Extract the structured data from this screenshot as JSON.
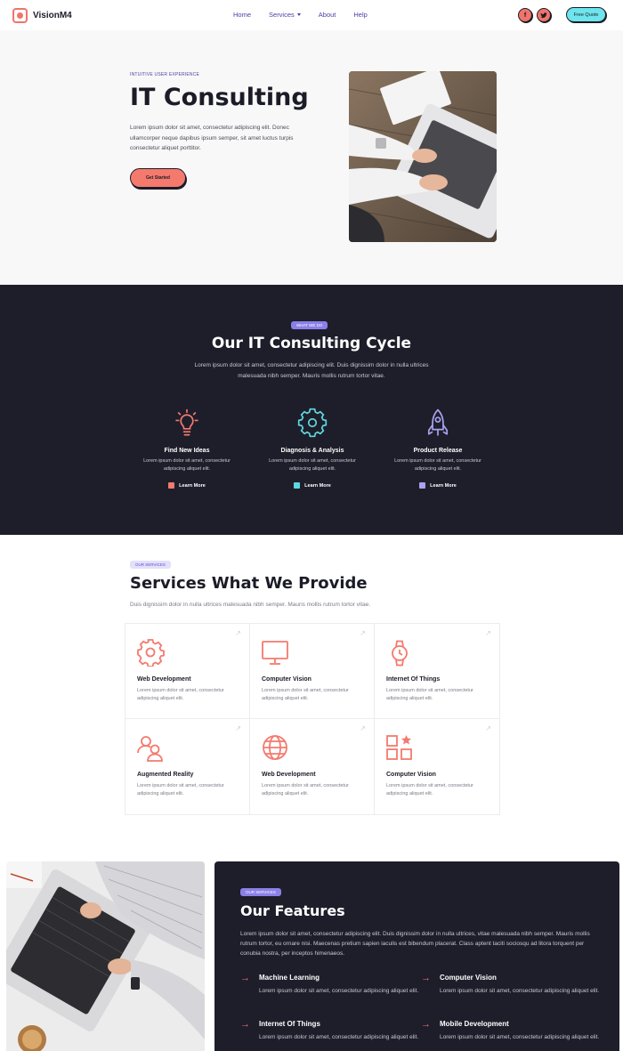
{
  "nav": {
    "logo": "VisionM4",
    "menu": [
      "Home",
      "Services",
      "About",
      "Help"
    ],
    "social": [
      "f",
      "t"
    ],
    "cta": "Free Quote"
  },
  "hero": {
    "eyebrow": "INTUITIVE USER EXPERIENCE",
    "title": "IT Consulting",
    "text": "Lorem ipsum dolor sit amet, consectetur adipiscing elit. Donec ullamcorper neque dapibus ipsum semper, sit amet luctus turpis consectetur aliquet porttitor.",
    "button": "Get Started"
  },
  "cycle": {
    "pill": "WHAT WE DO",
    "title": "Our IT Consulting Cycle",
    "text": "Lorem ipsum dolor sit amet, consectetur adipiscing elit. Duis dignissim dolor in nulla ultrices malesuada nibh semper. Mauris mollis rutrum tortor vitae.",
    "steps": [
      {
        "title": "Find New Ideas",
        "text": "Lorem ipsum dolor sit amet, consectetur adipiscing aliquet elit.",
        "link": "Learn More",
        "icon": "lightbulb-icon",
        "color": "#f47a6e"
      },
      {
        "title": "Diagnosis & Analysis",
        "text": "Lorem ipsum dolor sit amet, consectetur adipiscing aliquet elit.",
        "link": "Learn More",
        "icon": "gear-icon",
        "color": "#5fd8df"
      },
      {
        "title": "Product Release",
        "text": "Lorem ipsum dolor sit amet, consectetur adipiscing aliquet elit.",
        "link": "Learn More",
        "icon": "rocket-icon",
        "color": "#a9a2f0"
      }
    ]
  },
  "services": {
    "pill": "OUR SERVICES",
    "title": "Services What We Provide",
    "text": "Duis dignissim dolor in nulla ultrices malesuada nibh semper. Mauris mollis rutrum tortor vitae.",
    "items": [
      {
        "title": "Web Development",
        "text": "Lorem ipsum dolor sit amet, consectetur adipiscing aliquet elit.",
        "icon": "gear-icon"
      },
      {
        "title": "Computer Vision",
        "text": "Lorem ipsum dolor sit amet, consectetur adipiscing aliquet elit.",
        "icon": "monitor-icon"
      },
      {
        "title": "Internet Of Things",
        "text": "Lorem ipsum dolor sit amet, consectetur adipiscing aliquet elit.",
        "icon": "watch-icon"
      },
      {
        "title": "Augmented Reality",
        "text": "Lorem ipsum dolor sit amet, consectetur adipiscing aliquet elit.",
        "icon": "users-icon"
      },
      {
        "title": "Web Development",
        "text": "Lorem ipsum dolor sit amet, consectetur adipiscing aliquet elit.",
        "icon": "globe-icon"
      },
      {
        "title": "Computer Vision",
        "text": "Lorem ipsum dolor sit amet, consectetur adipiscing aliquet elit.",
        "icon": "grid-star-icon"
      }
    ]
  },
  "features": {
    "pill": "OUR SERVICES",
    "title": "Our Features",
    "text": "Lorem ipsum dolor sit amet, consectetur adipiscing elit. Duis dignissim dolor in nulla ultrices, vitae malesuada nibh semper. Mauris mollis rutrum tortor, eu ornare nisi. Maecenas pretium sapien iaculis est bibendum placerat. Class aptent taciti sociosqu ad litora torquent per conubia nostra, per inceptos himenaeos.",
    "items": [
      {
        "title": "Machine Learning",
        "text": "Lorem ipsum dolor sit amet, consectetur adipiscing aliquet elit."
      },
      {
        "title": "Computer Vision",
        "text": "Lorem ipsum dolor sit amet, consectetur adipiscing aliquet elit."
      },
      {
        "title": "Internet Of Things",
        "text": "Lorem ipsum dolor sit amet, consectetur adipiscing aliquet elit."
      },
      {
        "title": "Mobile Development",
        "text": "Lorem ipsum dolor sit amet, consectetur adipiscing aliquet elit."
      }
    ]
  },
  "colors": {
    "accent": "#f47a6e",
    "dark": "#1e1e2b",
    "cyan": "#6ee4ec",
    "purple": "#8b80e8"
  }
}
